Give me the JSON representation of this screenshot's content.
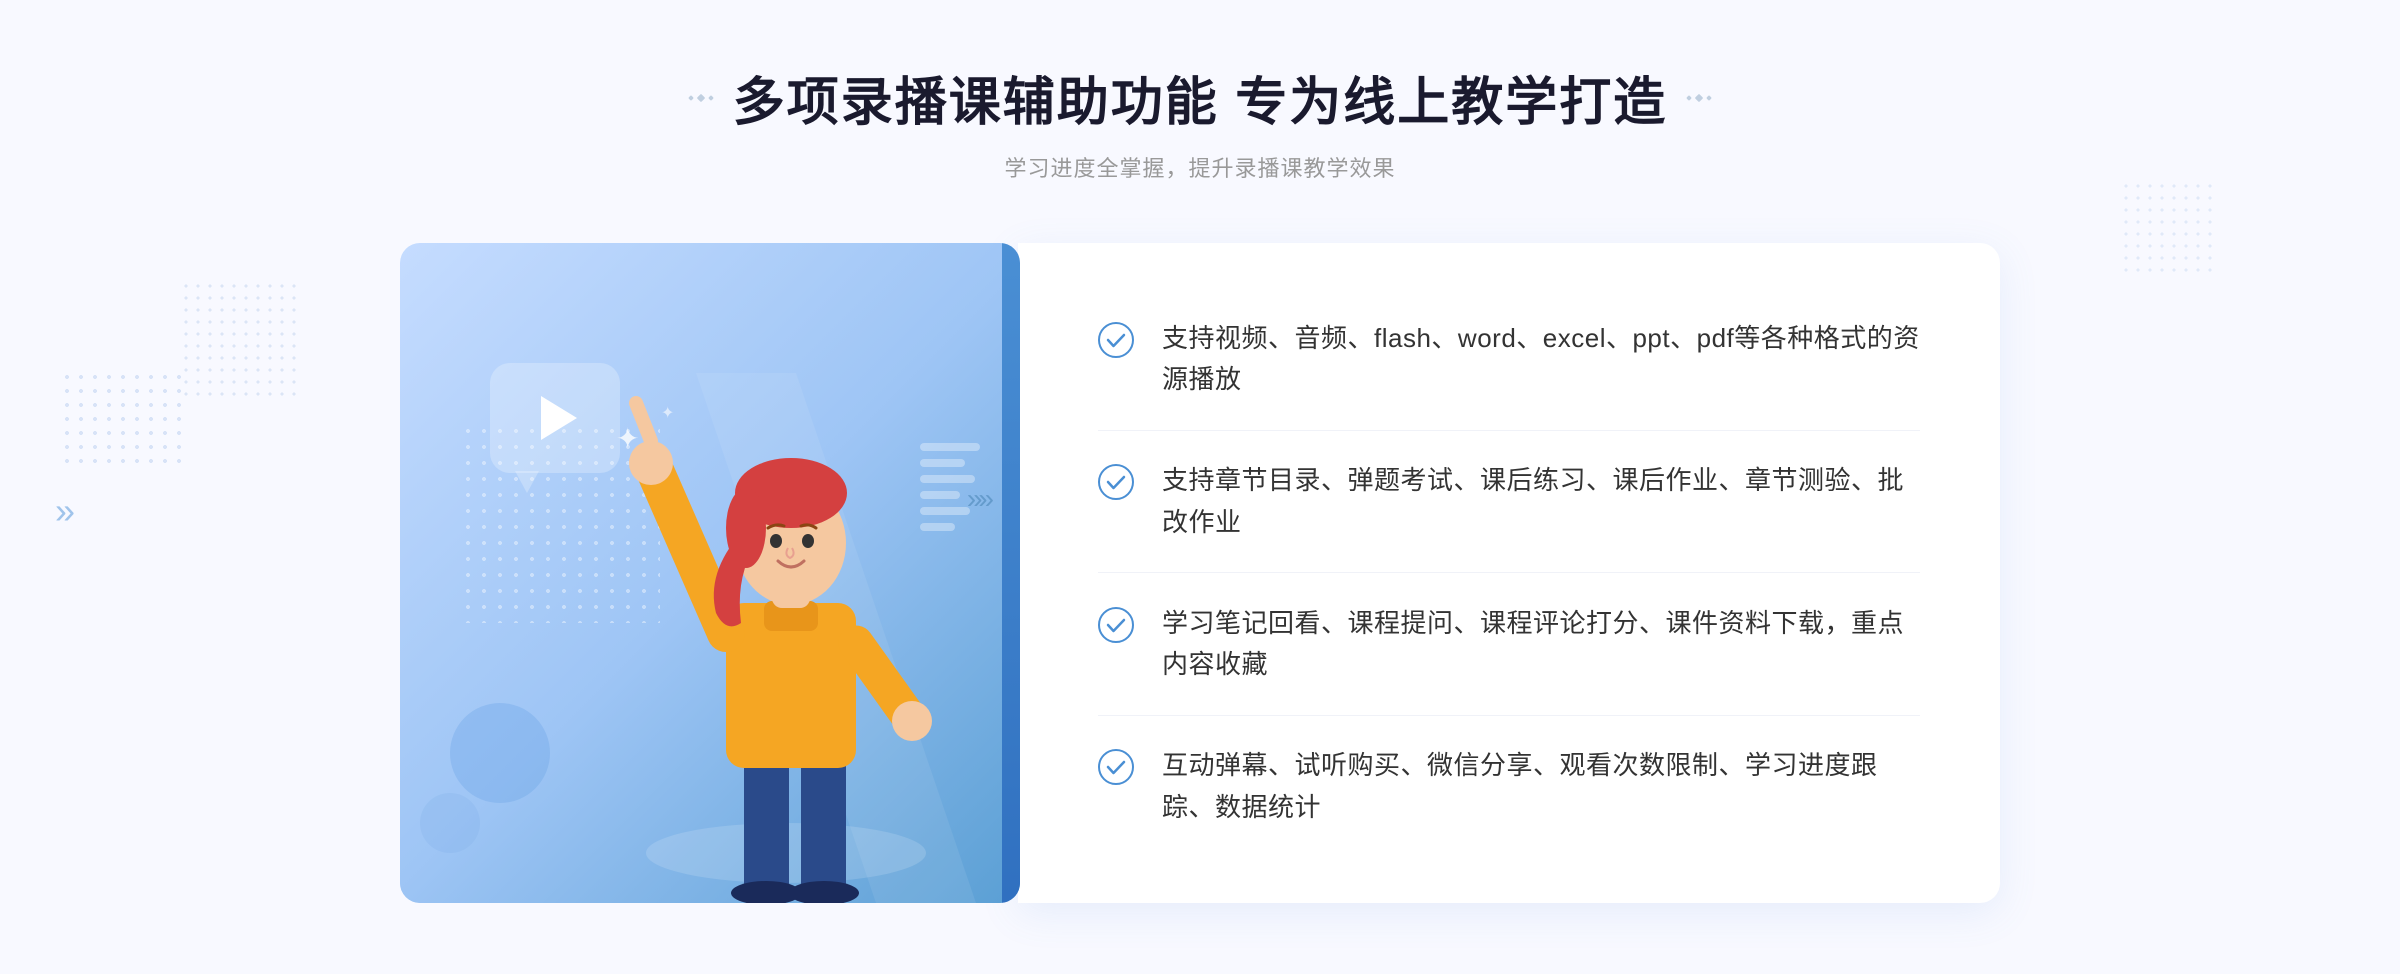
{
  "page": {
    "background_color": "#f4f7ff"
  },
  "header": {
    "title": "多项录播课辅助功能 专为线上教学打造",
    "subtitle": "学习进度全掌握，提升录播课教学效果",
    "title_dots_left": "❖",
    "title_dots_right": "❖"
  },
  "features": [
    {
      "id": 1,
      "text": "支持视频、音频、flash、word、excel、ppt、pdf等各种格式的资源播放"
    },
    {
      "id": 2,
      "text": "支持章节目录、弹题考试、课后练习、课后作业、章节测验、批改作业"
    },
    {
      "id": 3,
      "text": "学习笔记回看、课程提问、课程评论打分、课件资料下载，重点内容收藏"
    },
    {
      "id": 4,
      "text": "互动弹幕、试听购买、微信分享、观看次数限制、学习进度跟踪、数据统计"
    }
  ],
  "icons": {
    "check": "check-circle-icon",
    "play": "play-icon",
    "arrow_left": "»"
  },
  "colors": {
    "primary": "#4a8fd4",
    "accent": "#3070c0",
    "title": "#1a1a2e",
    "text": "#333333",
    "subtitle": "#999999",
    "bg": "#f4f7ff",
    "check_color": "#4a8fd4"
  }
}
